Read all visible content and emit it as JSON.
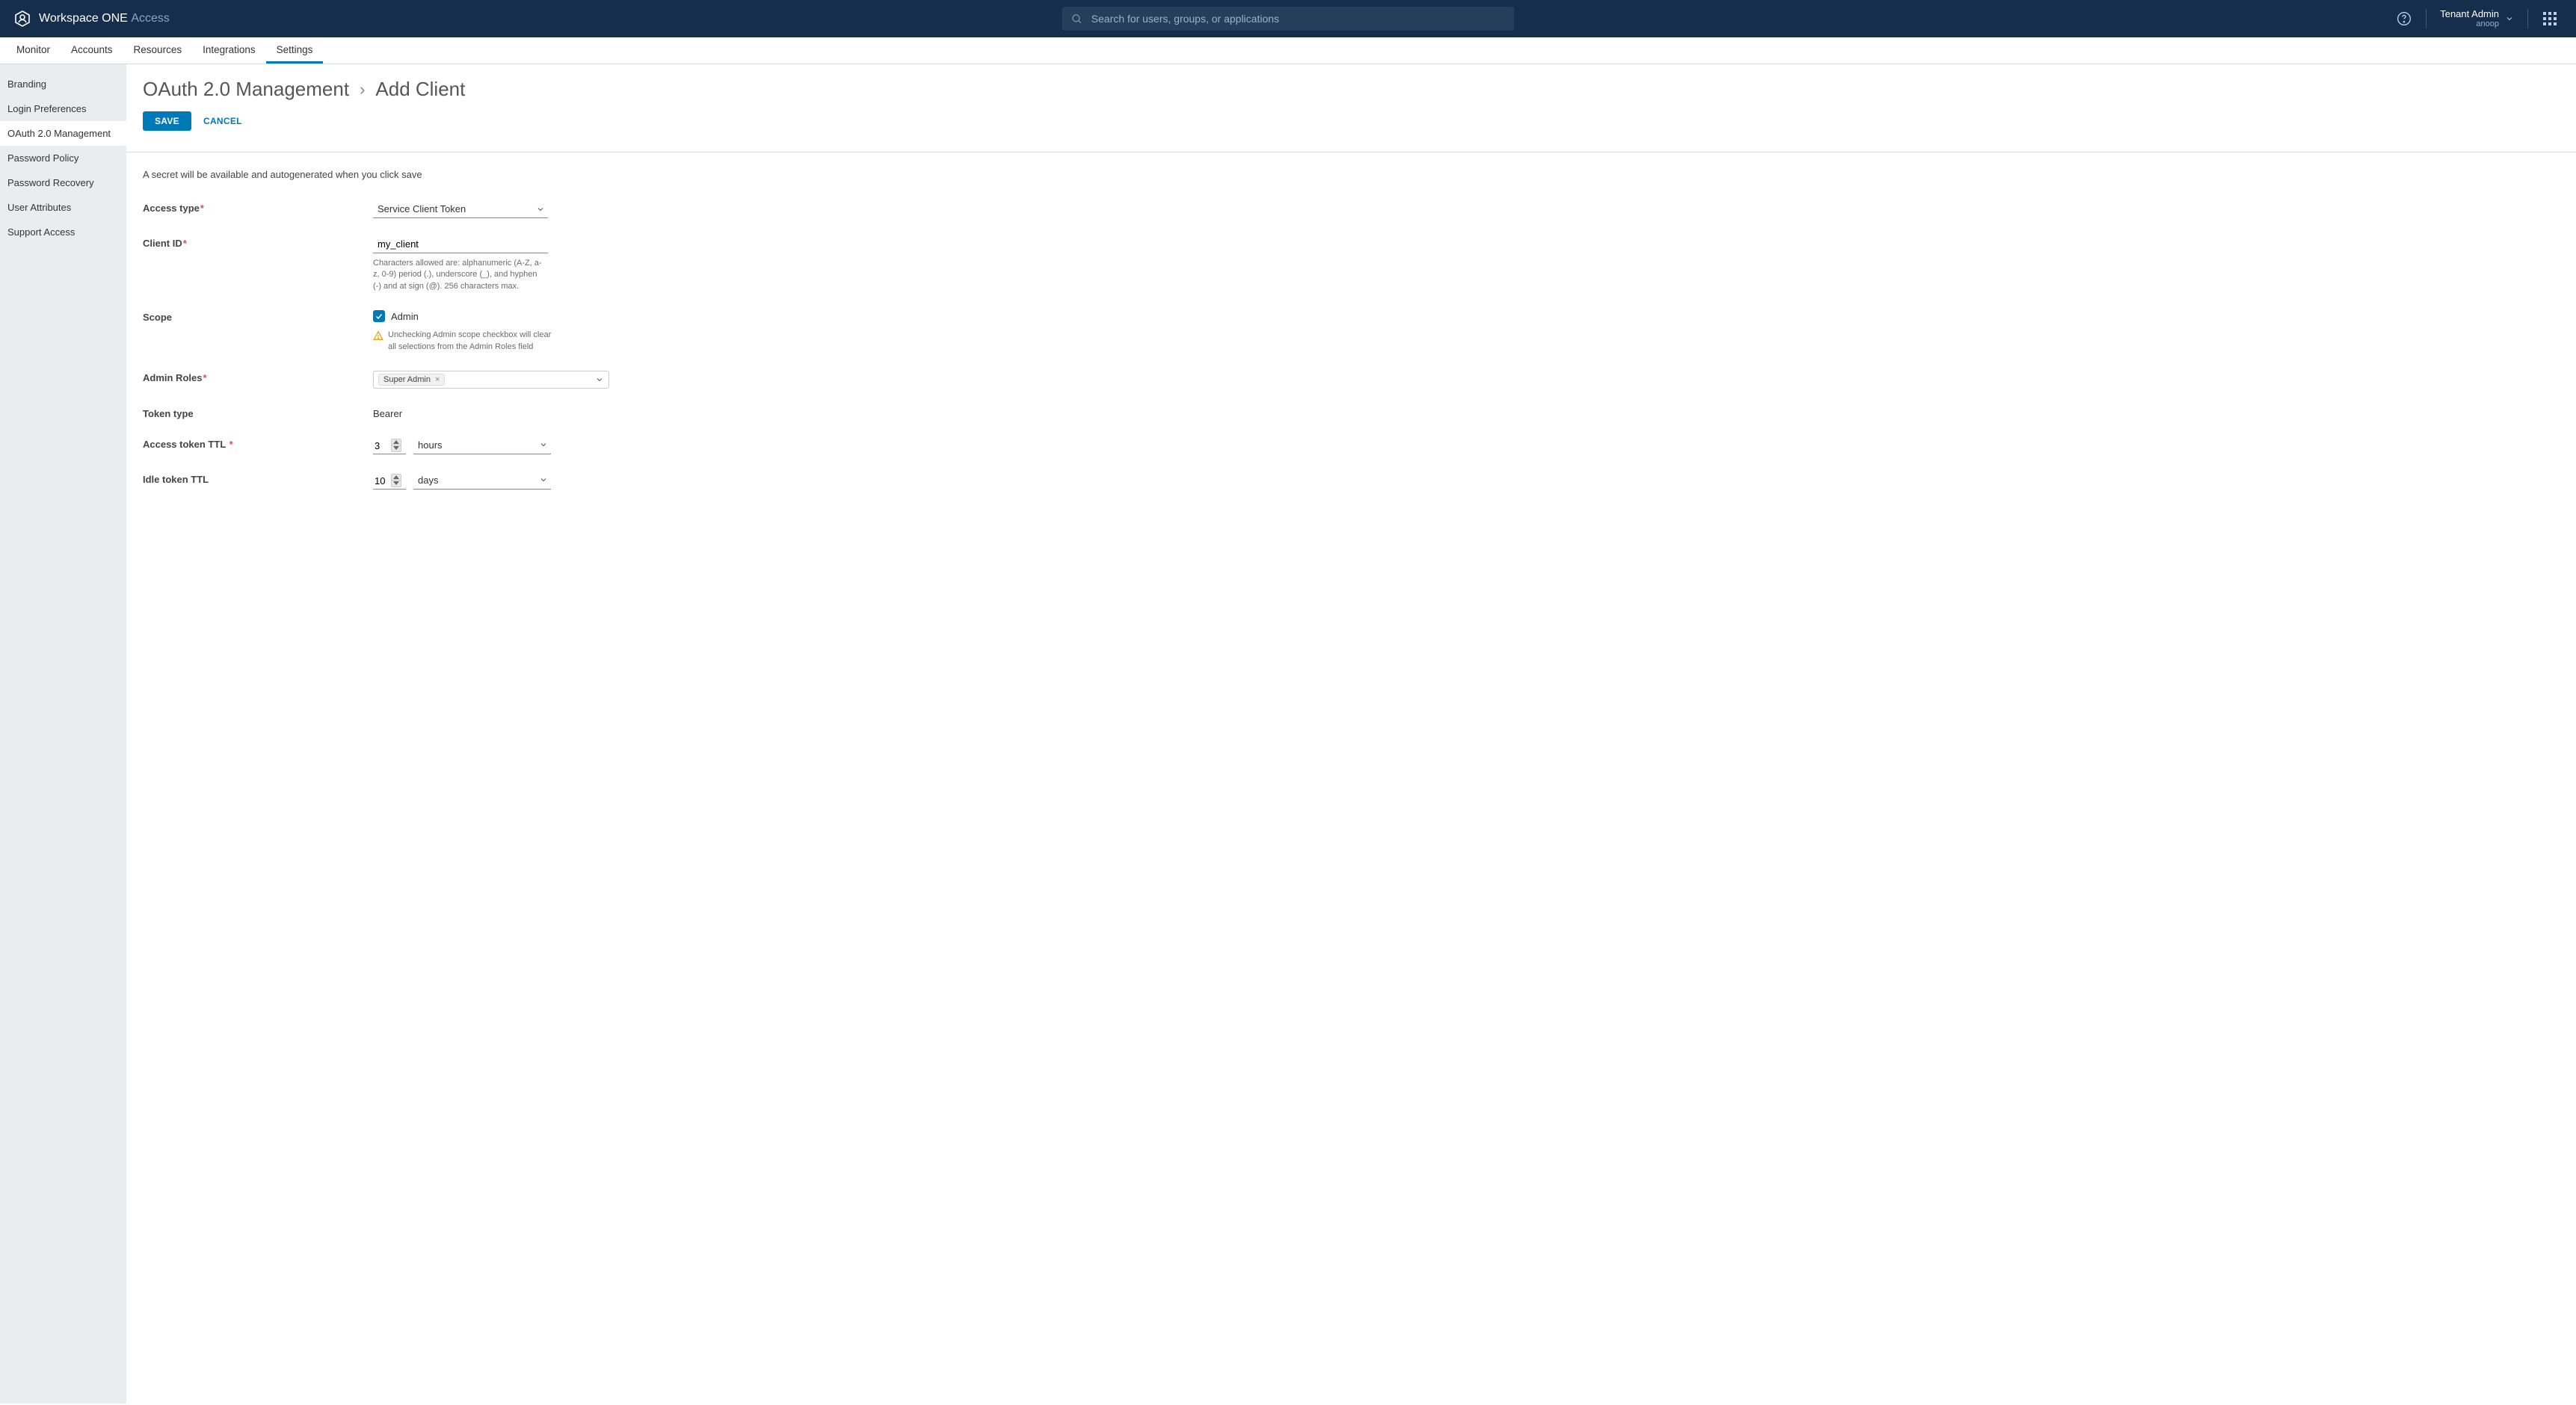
{
  "brand": {
    "main": "Workspace ONE",
    "sub": "Access"
  },
  "search": {
    "placeholder": "Search for users, groups, or applications"
  },
  "user": {
    "role": "Tenant Admin",
    "name": "anoop"
  },
  "tabs": [
    "Monitor",
    "Accounts",
    "Resources",
    "Integrations",
    "Settings"
  ],
  "tabs_active": 4,
  "sidebar": {
    "items": [
      "Branding",
      "Login Preferences",
      "OAuth 2.0 Management",
      "Password Policy",
      "Password Recovery",
      "User Attributes",
      "Support Access"
    ],
    "active": 2
  },
  "breadcrumb": {
    "main": "OAuth 2.0 Management",
    "sub": "Add Client"
  },
  "actions": {
    "save": "SAVE",
    "cancel": "CANCEL"
  },
  "form": {
    "info": "A secret will be available and autogenerated when you click save",
    "access_type": {
      "label": "Access type",
      "value": "Service Client Token"
    },
    "client_id": {
      "label": "Client ID",
      "value": "my_client",
      "helper": "Characters allowed are: alphanumeric (A-Z, a-z, 0-9) period (.), underscore (_), and hyphen (-) and at sign (@). 256 characters max."
    },
    "scope": {
      "label": "Scope",
      "option": "Admin",
      "warn": "Unchecking Admin scope checkbox will clear all selections from the Admin Roles field"
    },
    "admin_roles": {
      "label": "Admin Roles",
      "chip": "Super Admin"
    },
    "token_type": {
      "label": "Token type",
      "value": "Bearer"
    },
    "access_ttl": {
      "label": "Access token TTL",
      "value": "3",
      "unit": "hours"
    },
    "idle_ttl": {
      "label": "Idle token TTL",
      "value": "10",
      "unit": "days"
    }
  }
}
